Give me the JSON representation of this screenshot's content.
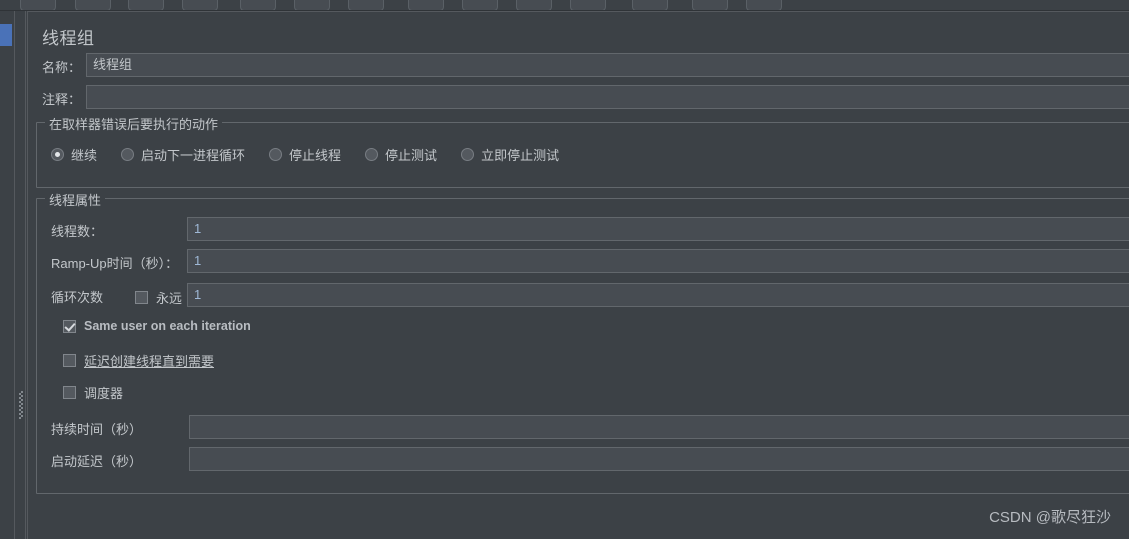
{
  "window": {
    "background_color": "#3c4146",
    "accent_color": "#4a72b8"
  },
  "toolbar": {
    "buttons": [
      {
        "name": "toolbar-button-1"
      },
      {
        "name": "toolbar-button-2"
      },
      {
        "name": "toolbar-button-3"
      },
      {
        "name": "toolbar-button-4"
      },
      {
        "name": "toolbar-button-5"
      },
      {
        "name": "toolbar-button-6"
      },
      {
        "name": "toolbar-button-7"
      },
      {
        "name": "toolbar-button-8"
      },
      {
        "name": "toolbar-button-9"
      },
      {
        "name": "toolbar-button-10"
      },
      {
        "name": "toolbar-button-11"
      },
      {
        "name": "toolbar-button-12"
      },
      {
        "name": "toolbar-button-13"
      },
      {
        "name": "toolbar-button-14"
      }
    ]
  },
  "panel": {
    "title": "线程组",
    "name_label": "名称：",
    "name_value": "线程组",
    "comment_label": "注释：",
    "comment_value": ""
  },
  "error_action": {
    "legend": "在取样器错误后要执行的动作",
    "options": [
      {
        "label": "继续",
        "selected": true
      },
      {
        "label": "启动下一进程循环",
        "selected": false
      },
      {
        "label": "停止线程",
        "selected": false
      },
      {
        "label": "停止测试",
        "selected": false
      },
      {
        "label": "立即停止测试",
        "selected": false
      }
    ]
  },
  "thread_properties": {
    "legend": "线程属性",
    "threads_label": "线程数：",
    "threads_value": "1",
    "rampup_label": "Ramp-Up时间（秒）：",
    "rampup_value": "1",
    "loops_label": "循环次数",
    "forever_label": "永远",
    "forever_checked": false,
    "loops_value": "1",
    "same_user_label": "Same user on each iteration",
    "same_user_checked": true,
    "delay_create_label": "延迟创建线程直到需要",
    "delay_create_checked": false,
    "scheduler_label": "调度器",
    "scheduler_checked": false,
    "duration_label": "持续时间（秒）",
    "duration_value": "",
    "startup_delay_label": "启动延迟（秒）",
    "startup_delay_value": ""
  },
  "watermark": {
    "text": "CSDN @歌尽狂沙"
  }
}
